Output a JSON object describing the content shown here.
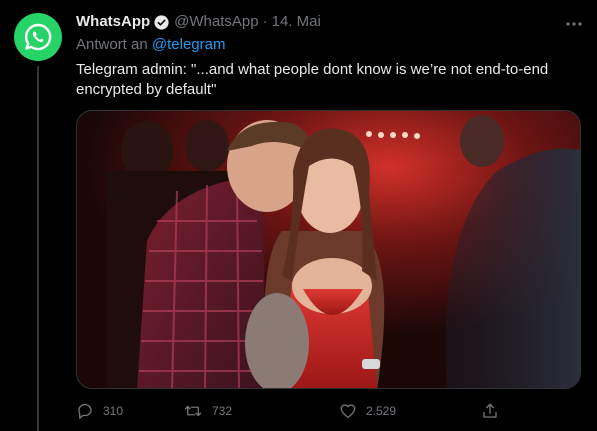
{
  "tweet": {
    "avatar_icon": "whatsapp-logo-icon",
    "display_name": "WhatsApp",
    "handle": "@WhatsApp",
    "separator": "·",
    "date": "14. Mai",
    "reply_prefix": "Antwort an",
    "reply_mention": "@telegram",
    "text": "Telegram admin: \"...and what people dont know is we’re not end-to-end encrypted by default\"",
    "media_icon": "nightclub-photo-image"
  },
  "actions": {
    "reply_count": "310",
    "retweet_count": "732",
    "like_count": "2.529"
  },
  "colors": {
    "whatsapp_green": "#25d366",
    "link_blue": "#1d9bf0",
    "muted_text": "#71767b",
    "background": "#000000"
  }
}
